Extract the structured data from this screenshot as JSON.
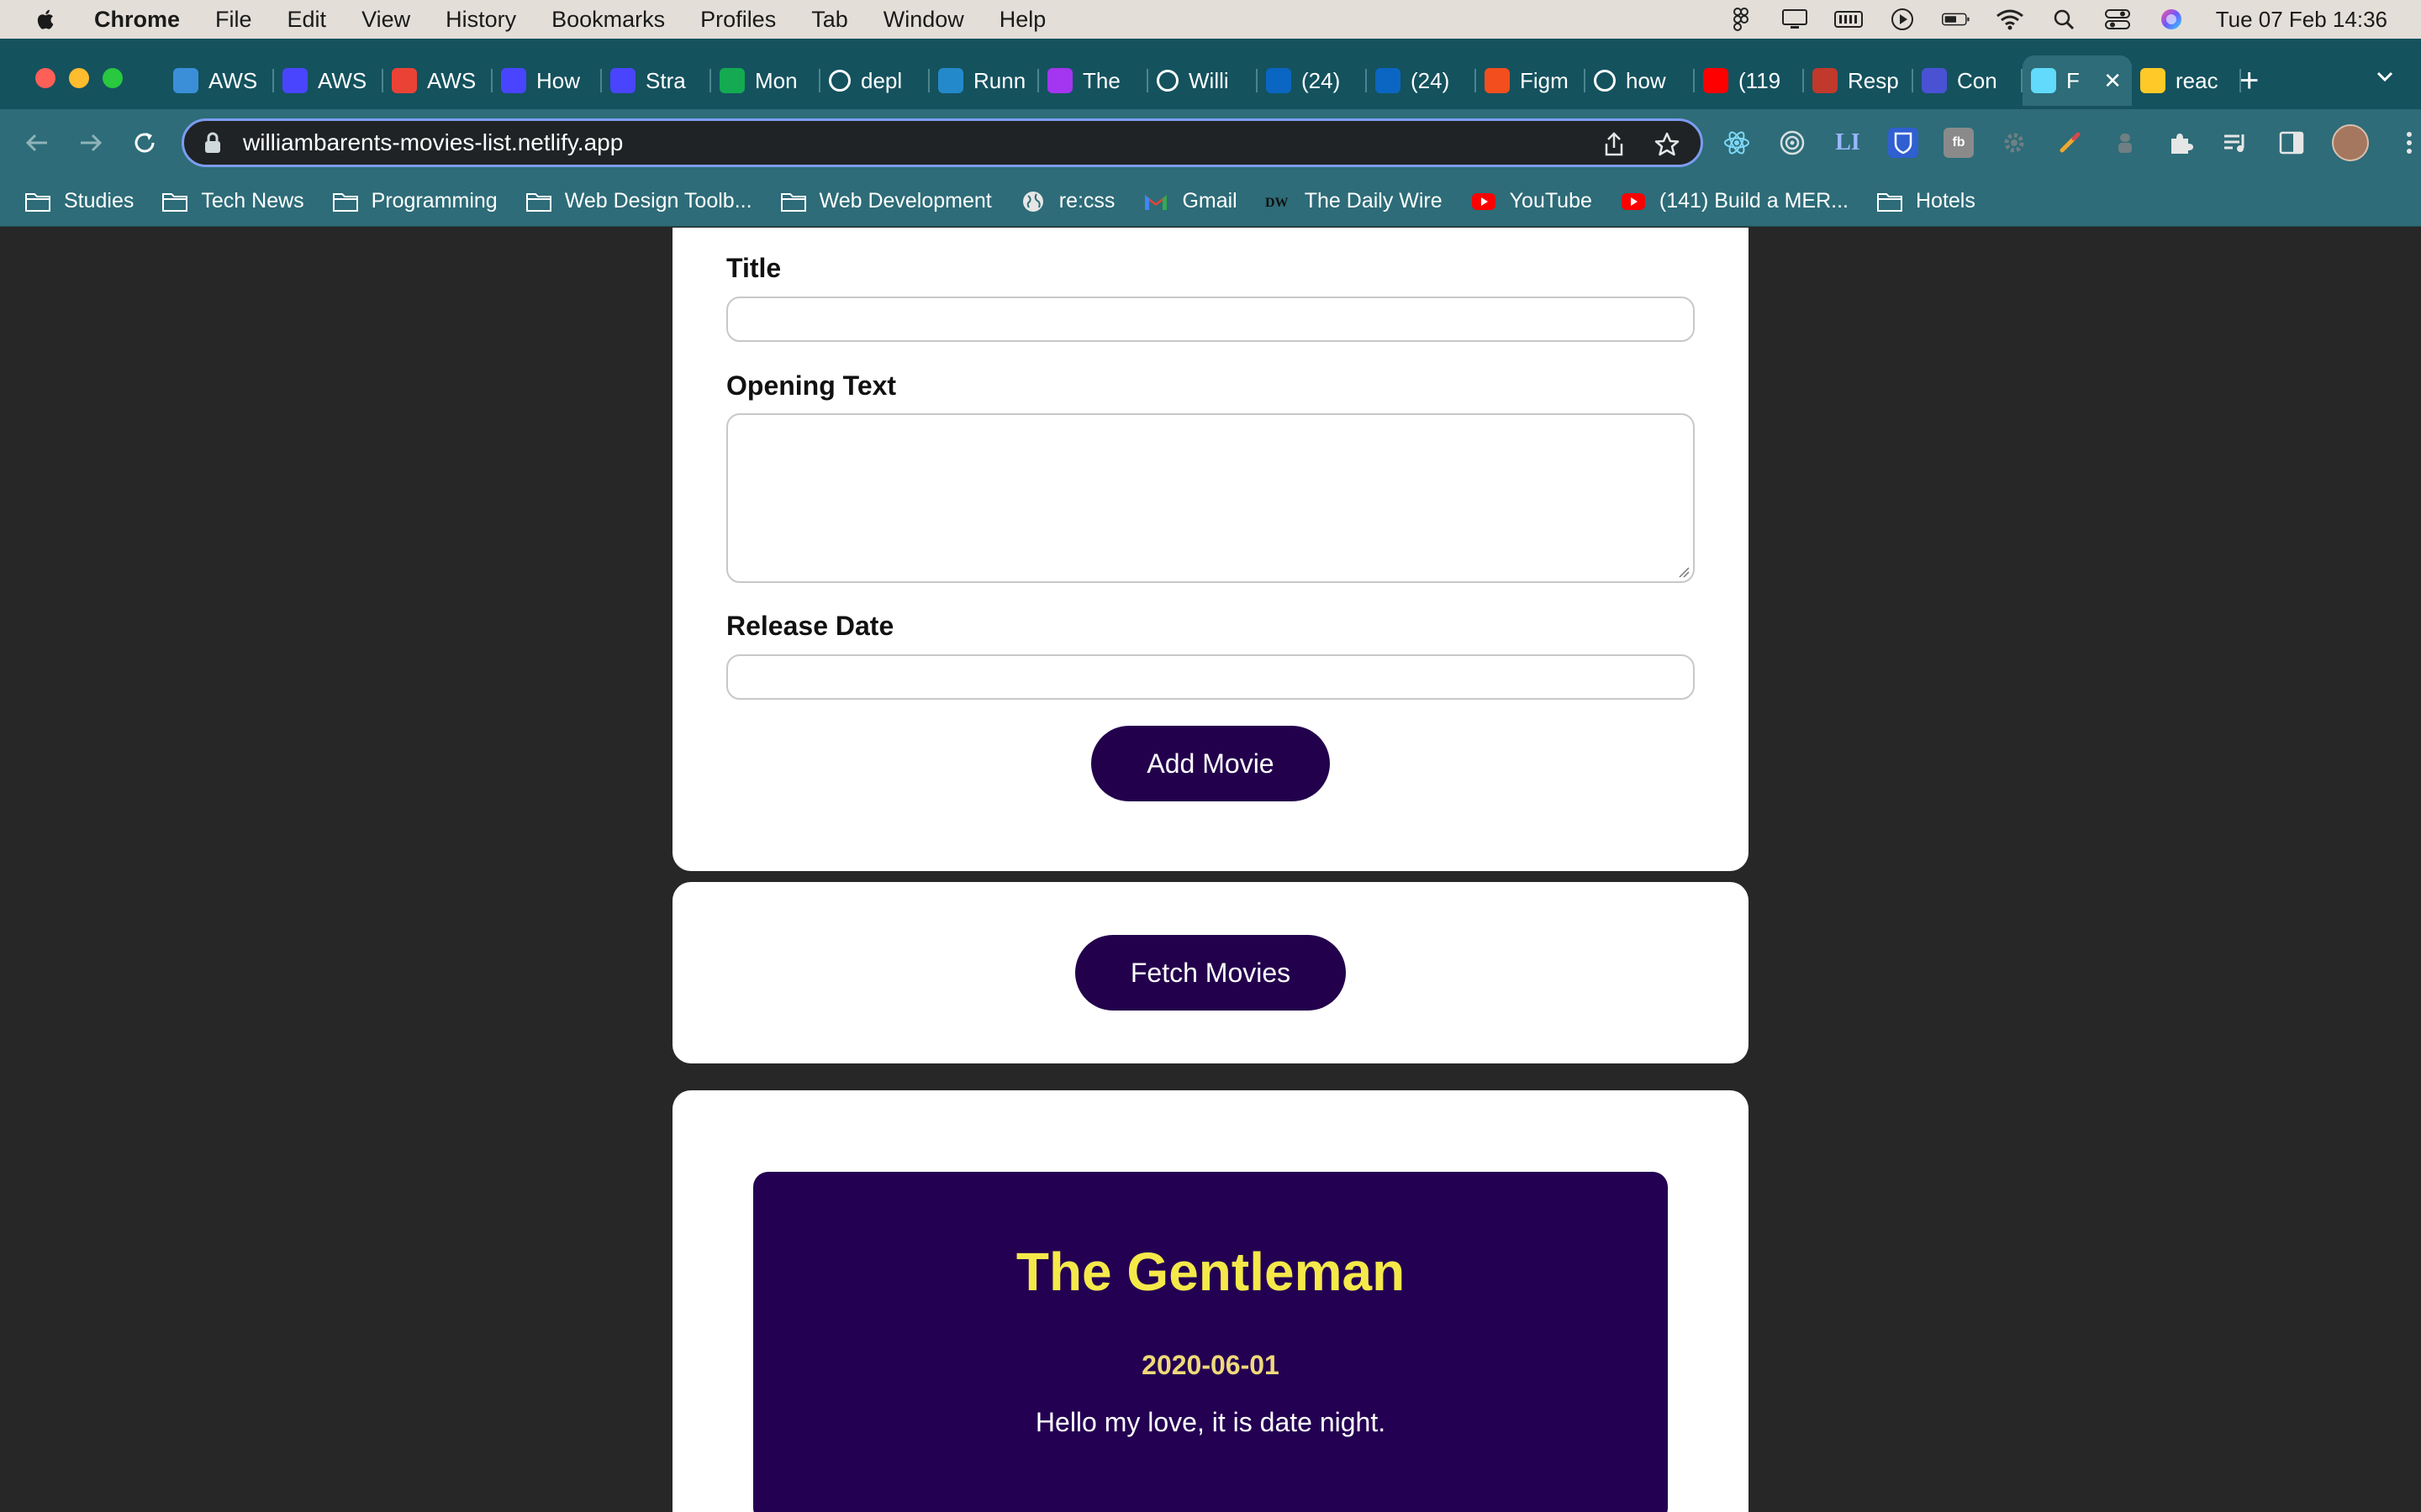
{
  "menubar": {
    "app_name": "Chrome",
    "items": [
      "File",
      "Edit",
      "View",
      "History",
      "Bookmarks",
      "Profiles",
      "Tab",
      "Window",
      "Help"
    ],
    "clock": "Tue 07 Feb  14:36"
  },
  "tabs": [
    {
      "label": "AWS",
      "icon": "globe-icon",
      "color": "#3a8fd8"
    },
    {
      "label": "AWS",
      "icon": "strapi-icon",
      "color": "#4945ff"
    },
    {
      "label": "AWS",
      "icon": "gmail-icon",
      "color": "#ea4335"
    },
    {
      "label": "How",
      "icon": "strapi-icon",
      "color": "#4945ff"
    },
    {
      "label": "Stra",
      "icon": "strapi-icon",
      "color": "#4945ff"
    },
    {
      "label": "Mon",
      "icon": "mongodb-icon",
      "color": "#13aa52"
    },
    {
      "label": "depl",
      "icon": "google-icon",
      "color": "#ffffff"
    },
    {
      "label": "Runn",
      "icon": "vscode-icon",
      "color": "#2489ca"
    },
    {
      "label": "The",
      "icon": "udemy-icon",
      "color": "#a435f0"
    },
    {
      "label": "Willi",
      "icon": "github-icon",
      "color": "#ffffff"
    },
    {
      "label": "(24)",
      "icon": "linkedin-icon",
      "color": "#0a66c2"
    },
    {
      "label": "(24)",
      "icon": "linkedin-icon",
      "color": "#0a66c2"
    },
    {
      "label": "Figm",
      "icon": "figma-icon",
      "color": "#f24e1e"
    },
    {
      "label": "how",
      "icon": "google-icon",
      "color": "#ffffff"
    },
    {
      "label": "(119",
      "icon": "youtube-icon",
      "color": "#ff0000"
    },
    {
      "label": "Resp",
      "icon": "spy-icon",
      "color": "#c0392b"
    },
    {
      "label": "Con",
      "icon": "medium-icon",
      "color": "#4a52d4"
    },
    {
      "label": "F",
      "icon": "react-icon",
      "color": "#61dafb",
      "active": true
    },
    {
      "label": "reac",
      "icon": "firebase-icon",
      "color": "#ffca28"
    }
  ],
  "toolbar": {
    "url": "williambarents-movies-list.netlify.app"
  },
  "bookmarks": [
    {
      "label": "Studies",
      "icon": "folder-icon"
    },
    {
      "label": "Tech News",
      "icon": "folder-icon"
    },
    {
      "label": "Programming",
      "icon": "folder-icon"
    },
    {
      "label": "Web Design Toolb...",
      "icon": "folder-icon"
    },
    {
      "label": "Web Development",
      "icon": "folder-icon"
    },
    {
      "label": "re:css",
      "icon": "globe-icon"
    },
    {
      "label": "Gmail",
      "icon": "gmail-icon"
    },
    {
      "label": "The Daily Wire",
      "icon": "dailywire-icon"
    },
    {
      "label": "YouTube",
      "icon": "youtube-icon"
    },
    {
      "label": "(141) Build a MER...",
      "icon": "youtube-icon"
    },
    {
      "label": "Hotels",
      "icon": "folder-icon"
    }
  ],
  "form": {
    "title_label": "Title",
    "title_value": "",
    "opening_text_label": "Opening Text",
    "opening_text_value": "",
    "release_date_label": "Release Date",
    "release_date_value": "",
    "add_button": "Add Movie"
  },
  "controls": {
    "fetch_button": "Fetch Movies"
  },
  "movies": [
    {
      "title": "The Gentleman",
      "release_date": "2020-06-01",
      "opening_text": "Hello my love, it is date night."
    }
  ],
  "colors": {
    "page_bg": "#272727",
    "button_bg": "#23004c",
    "movie_card_bg": "#230052",
    "movie_title": "#f5e94a",
    "chrome_frame": "#14525e",
    "chrome_toolbar": "#2d6c78"
  }
}
